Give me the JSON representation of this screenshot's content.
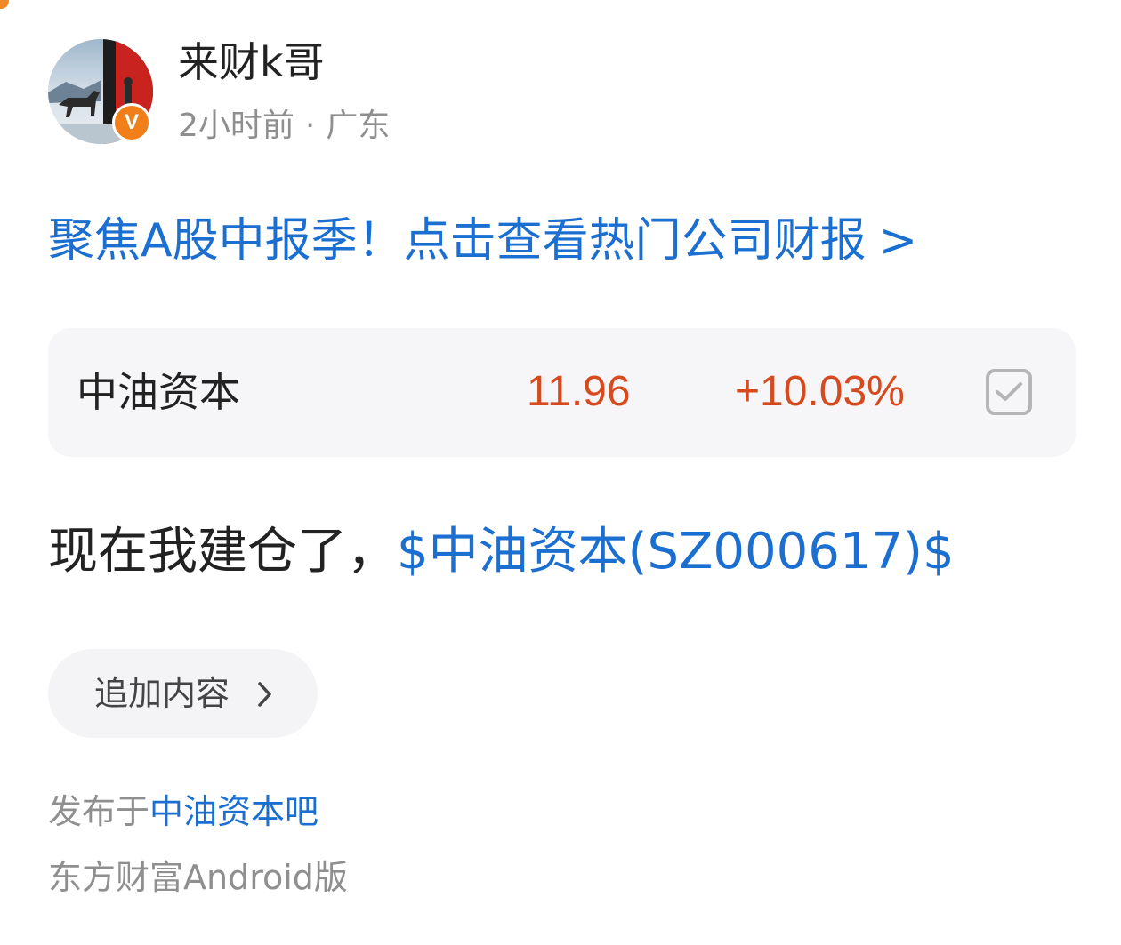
{
  "author": {
    "name": "来财k哥",
    "time": "2小时前",
    "separator": "·",
    "location": "广东",
    "badge": "V"
  },
  "promo": {
    "text": "聚焦A股中报季！点击查看热门公司财报",
    "chevron": ">"
  },
  "stock_card": {
    "name": "中油资本",
    "price": "11.96",
    "change": "+10.03%",
    "price_color": "#d74a1e",
    "checked": true
  },
  "post": {
    "text": "现在我建仓了，",
    "stock_tag": "$中油资本(SZ000617)$"
  },
  "append_button": {
    "label": "追加内容",
    "icon": "chevron-right-icon"
  },
  "footer": {
    "published_prefix": "发布于",
    "bar_name": "中油资本吧",
    "source": "东方财富Android版"
  },
  "colors": {
    "link": "#1b6fd1",
    "badge": "#f07f1a",
    "muted": "#8f8f8f",
    "card_bg": "#f6f6f8"
  }
}
